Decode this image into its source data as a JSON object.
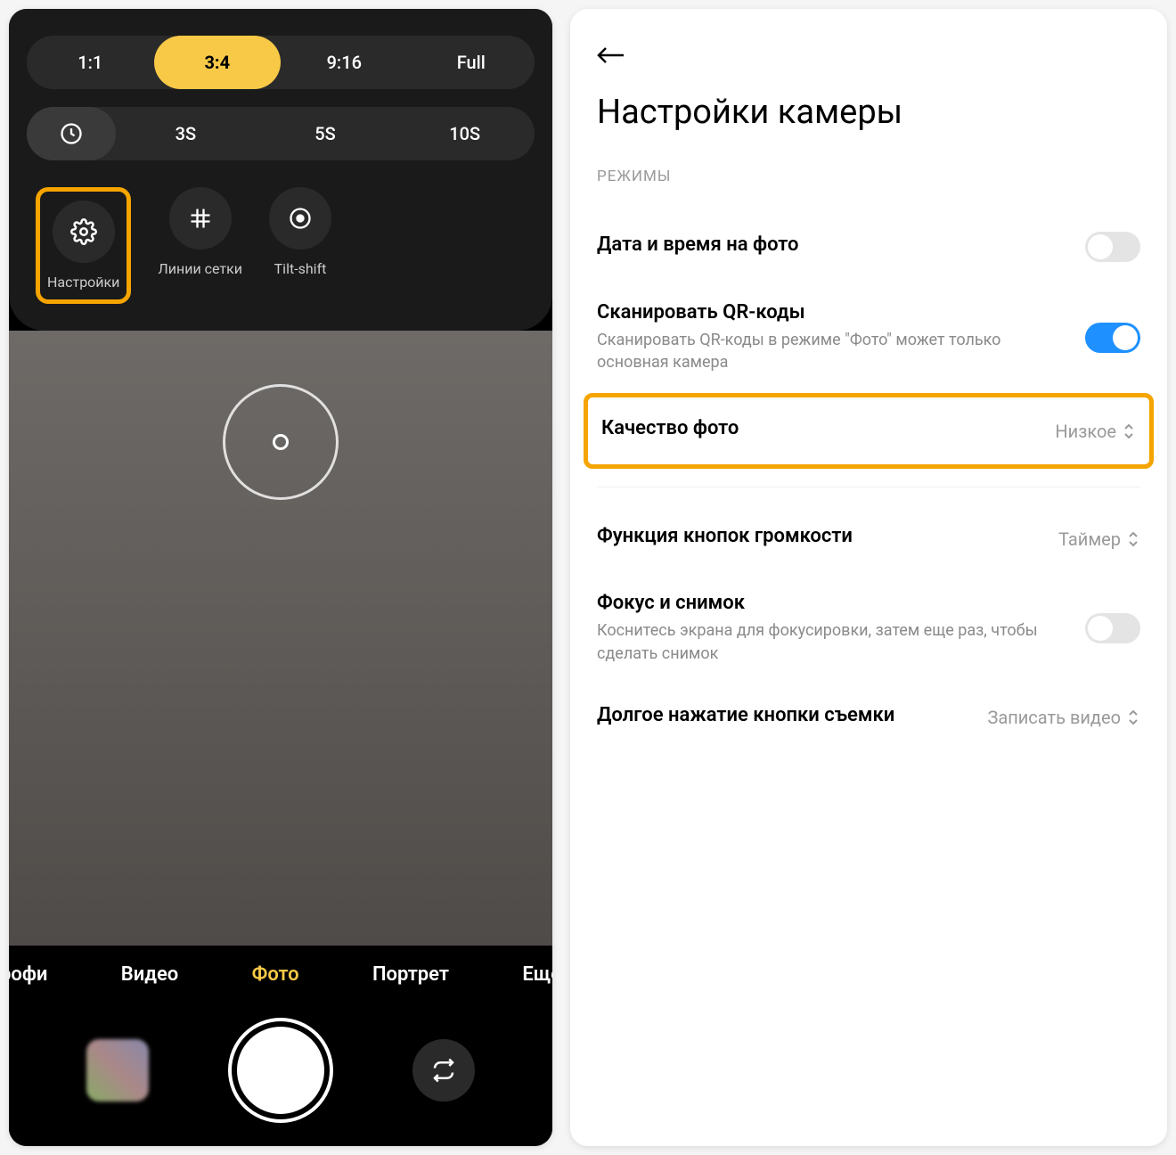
{
  "camera": {
    "aspect_ratios": [
      "1:1",
      "3:4",
      "9:16",
      "Full"
    ],
    "aspect_active_index": 1,
    "timer_options": [
      "3S",
      "5S",
      "10S"
    ],
    "quick_actions": [
      {
        "label": "Настройки",
        "icon": "gear"
      },
      {
        "label": "Линии сетки",
        "icon": "grid"
      },
      {
        "label": "Tilt-shift",
        "icon": "target"
      }
    ],
    "modes": [
      "рофи",
      "Видео",
      "Фото",
      "Портрет",
      "Ещё"
    ],
    "mode_active_index": 2
  },
  "settings": {
    "title": "Настройки камеры",
    "section_label": "РЕЖИМЫ",
    "rows": [
      {
        "title": "Дата и время на фото",
        "desc": "",
        "type": "toggle",
        "on": false
      },
      {
        "title": "Сканировать QR-коды",
        "desc": "Сканировать QR-коды в режиме \"Фото\" может только основная камера",
        "type": "toggle",
        "on": true
      },
      {
        "title": "Качество фото",
        "desc": "",
        "type": "select",
        "value": "Низкое",
        "highlighted": true
      },
      {
        "title": "Функция кнопок громкости",
        "desc": "",
        "type": "select",
        "value": "Таймер"
      },
      {
        "title": "Фокус и снимок",
        "desc": "Коснитесь экрана для фокусировки, затем еще раз, чтобы сделать снимок",
        "type": "toggle",
        "on": false
      },
      {
        "title": "Долгое нажатие кнопки съемки",
        "desc": "",
        "type": "select",
        "value": "Записать видео"
      }
    ]
  }
}
